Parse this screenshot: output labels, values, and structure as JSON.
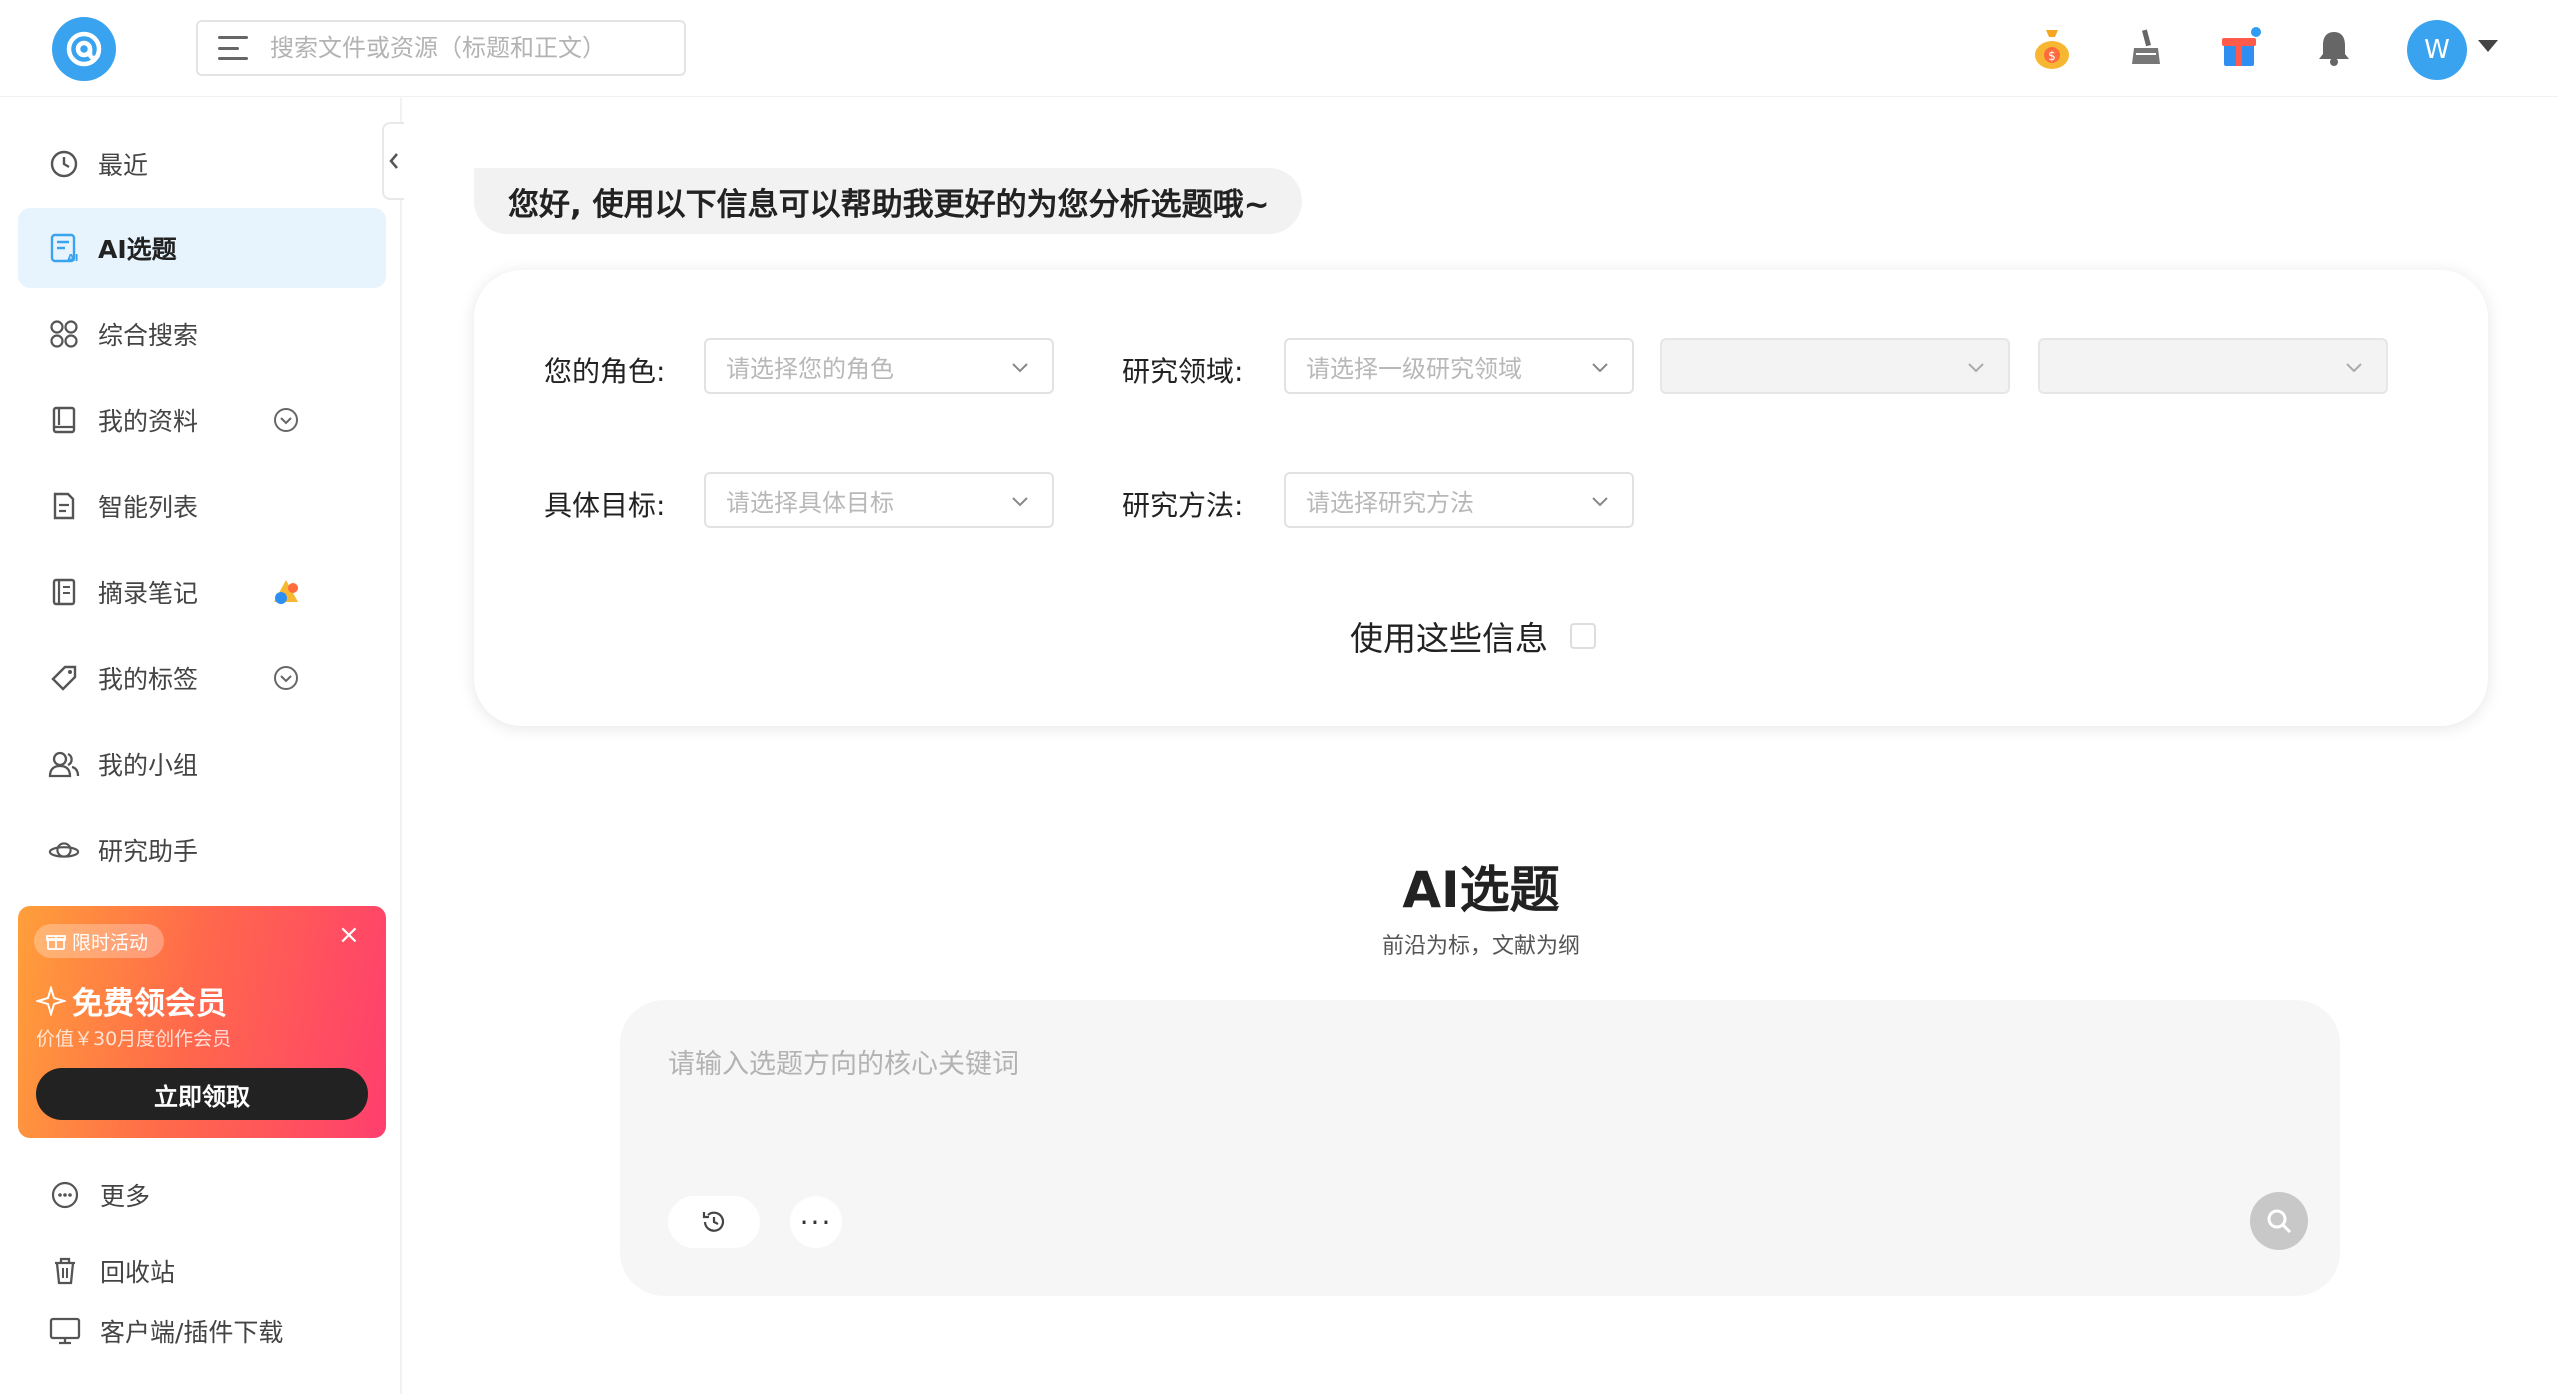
{
  "search": {
    "placeholder": "搜索文件或资源（标题和正文）"
  },
  "user": {
    "avatar_letter": "W"
  },
  "sidebar": {
    "items": [
      {
        "label": "最近"
      },
      {
        "label": "AI选题"
      },
      {
        "label": "综合搜索"
      },
      {
        "label": "我的资料"
      },
      {
        "label": "智能列表"
      },
      {
        "label": "摘录笔记"
      },
      {
        "label": "我的标签"
      },
      {
        "label": "我的小组"
      },
      {
        "label": "研究助手"
      }
    ],
    "promo": {
      "tag": "限时活动",
      "title": "免费领会员",
      "subtitle": "价值￥30月度创作会员",
      "button": "立即领取",
      "close": "×"
    },
    "bottom": [
      {
        "label": "更多"
      },
      {
        "label": "回收站"
      },
      {
        "label": "客户端/插件下载"
      }
    ]
  },
  "main": {
    "greeting": "您好, 使用以下信息可以帮助我更好的为您分析选题哦~",
    "form": {
      "role_label": "您的角色:",
      "role_placeholder": "请选择您的角色",
      "field_label": "研究领域:",
      "field_placeholder": "请选择一级研究领域",
      "goal_label": "具体目标:",
      "goal_placeholder": "请选择具体目标",
      "method_label": "研究方法:",
      "method_placeholder": "请选择研究方法",
      "use_info_label": "使用这些信息"
    },
    "hero": {
      "title": "AI选题",
      "subtitle": "前沿为标，文献为纲"
    },
    "composer": {
      "placeholder": "请输入选题方向的核心关键词",
      "more": "···"
    }
  },
  "colors": {
    "accent": "#3aa3ef",
    "active_bg": "#e7f4fd",
    "promo_start": "#ff9f3a",
    "promo_end": "#ff3e6e"
  }
}
